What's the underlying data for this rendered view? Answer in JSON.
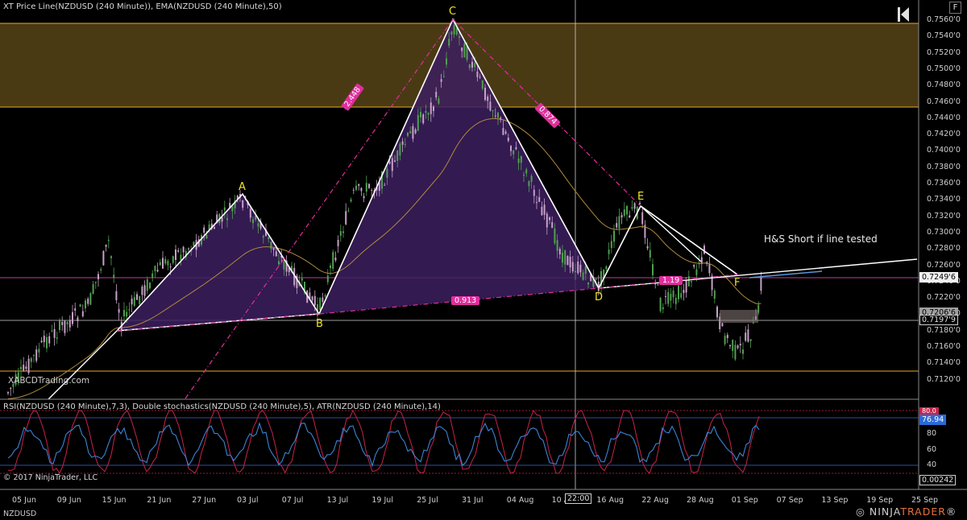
{
  "header": {
    "title": "XT Price Line(NZDUSD (240 Minute)), EMA(NZDUSD (240 Minute),50)",
    "f_button": "F"
  },
  "indicator_panel": {
    "title": "RSI(NZDUSD (240 Minute),7,3), Double stochastics(NZDUSD (240 Minute),5), ATR(NZDUSD (240 Minute),14)"
  },
  "footer": {
    "copyright": "© 2017 NinjaTrader, LLC",
    "symbol": "NZDUSD",
    "brand_main": "NINJA",
    "brand_accent": "TRADER",
    "brand_mark": "®"
  },
  "watermark": "XABCDTrading.com",
  "annotation": "H&S Short if line tested",
  "pattern_points": {
    "A": "A",
    "B": "B",
    "C": "C",
    "D": "D",
    "E": "E",
    "F": "F"
  },
  "ratios": {
    "xb": "0.913",
    "xc": "2.448",
    "cd": "0.874",
    "ef": "1.19"
  },
  "price_axis": [
    "0.7560'0",
    "0.7540'0",
    "0.7520'0",
    "0.7500'0",
    "0.7480'0",
    "0.7460'0",
    "0.7440'0",
    "0.7420'0",
    "0.7400'0",
    "0.7380'0",
    "0.7360'0",
    "0.7340'0",
    "0.7320'0",
    "0.7300'0",
    "0.7280'0",
    "0.7260'0",
    "0.7240'0",
    "0.7220'0",
    "0.7200'0",
    "0.7180'0",
    "0.7160'0",
    "0.7140'0",
    "0.7120'0"
  ],
  "price_tags": {
    "current": "0.7249'6",
    "ema": "0.7206'6",
    "cursor": "0.7197'9"
  },
  "indicator_axis": [
    "80",
    "60",
    "40",
    "20"
  ],
  "indicator_tags": {
    "rsi": "76.94",
    "top": "80.0",
    "atr": "0.00242"
  },
  "date_axis": [
    "05 Jun",
    "09 Jun",
    "15 Jun",
    "21 Jun",
    "27 Jun",
    "03 Jul",
    "07 Jul",
    "13 Jul",
    "19 Jul",
    "25 Jul",
    "31 Jul",
    "04 Aug",
    "10 Aug",
    "16 Aug",
    "22 Aug",
    "28 Aug",
    "01 Sep",
    "07 Sep",
    "13 Sep",
    "19 Sep",
    "25 Sep"
  ],
  "cursor_time": "22:00",
  "colors": {
    "resistance_zone": "#4a3a14",
    "zone_border": "#e7a926",
    "purple_fill": "#3c1f5f",
    "magenta": "#e02e9c",
    "bull": "#4fa04f",
    "bear": "#c8a0c8",
    "rsi": "#3a84d6",
    "stoch": "#c8234a"
  }
}
